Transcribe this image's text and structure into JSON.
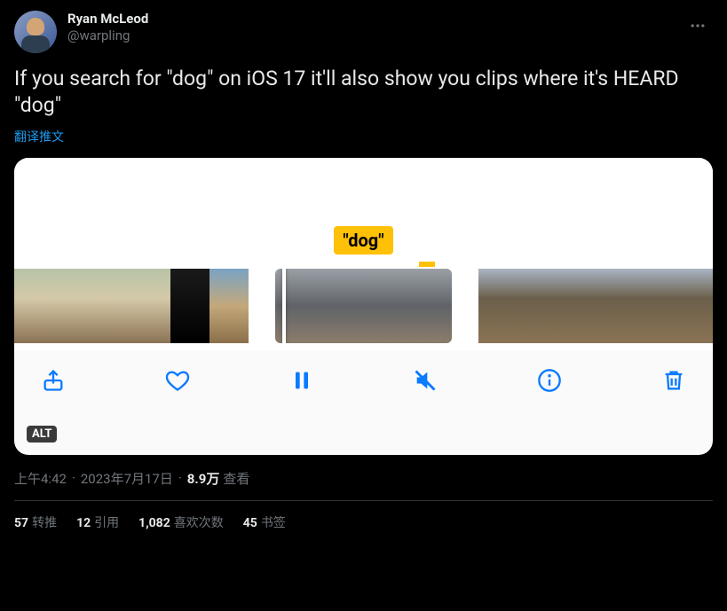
{
  "user": {
    "display_name": "Ryan McLeod",
    "handle": "@warpling"
  },
  "tweet_text": "If you search for \"dog\" on iOS 17 it'll also show you clips where it's HEARD \"dog\"",
  "translate_label": "翻译推文",
  "media": {
    "caption_chip": "\"dog\"",
    "alt_badge": "ALT",
    "toolbar_icons": {
      "share": "share-icon",
      "heart": "heart-icon",
      "pause": "pause-icon",
      "mute": "mute-icon",
      "info": "info-icon",
      "trash": "trash-icon"
    }
  },
  "meta": {
    "time": "上午4:42",
    "date": "2023年7月17日",
    "views_count": "8.9万",
    "views_label": "查看"
  },
  "stats": {
    "retweets": {
      "count": "57",
      "label": "转推"
    },
    "quotes": {
      "count": "12",
      "label": "引用"
    },
    "likes": {
      "count": "1,082",
      "label": "喜欢次数"
    },
    "bookmarks": {
      "count": "45",
      "label": "书签"
    }
  }
}
